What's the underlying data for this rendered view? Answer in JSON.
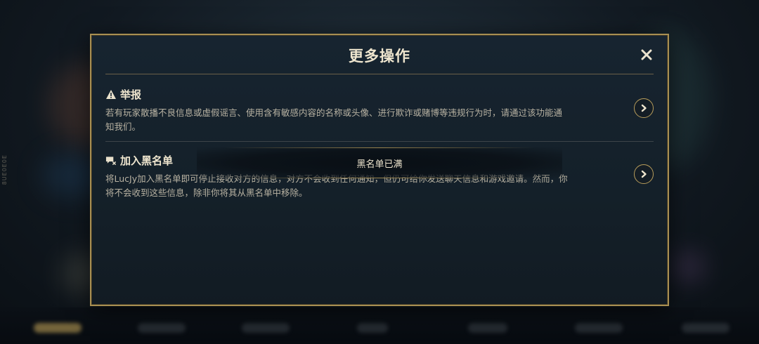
{
  "side_label": "8UE0E0E",
  "dialog": {
    "title": "更多操作",
    "close_icon": "close-icon",
    "report": {
      "icon": "warning-icon",
      "title": "举报",
      "description": "若有玩家散播不良信息或虚假谣言、使用含有敏感内容的名称或头像、进行欺诈或赌博等违规行为时，请通过该功能通知我们。",
      "action_icon": "chevron-right-icon"
    },
    "blacklist": {
      "icon": "block-message-icon",
      "title": "加入黑名单",
      "description": "将LucJy加入黑名单即可停止接收对方的信息，对方不会收到任何通知，但仍可给你发送聊天信息和游戏邀请。然而，你将不会收到这些信息，除非你将其从黑名单中移除。",
      "action_icon": "chevron-right-icon"
    }
  },
  "toast": {
    "text": "黑名单已满"
  },
  "colors": {
    "gold_border": "#a88f52",
    "title_text": "#efe6cf",
    "body_text": "#b8b2a2",
    "panel_bg": "#172430"
  }
}
